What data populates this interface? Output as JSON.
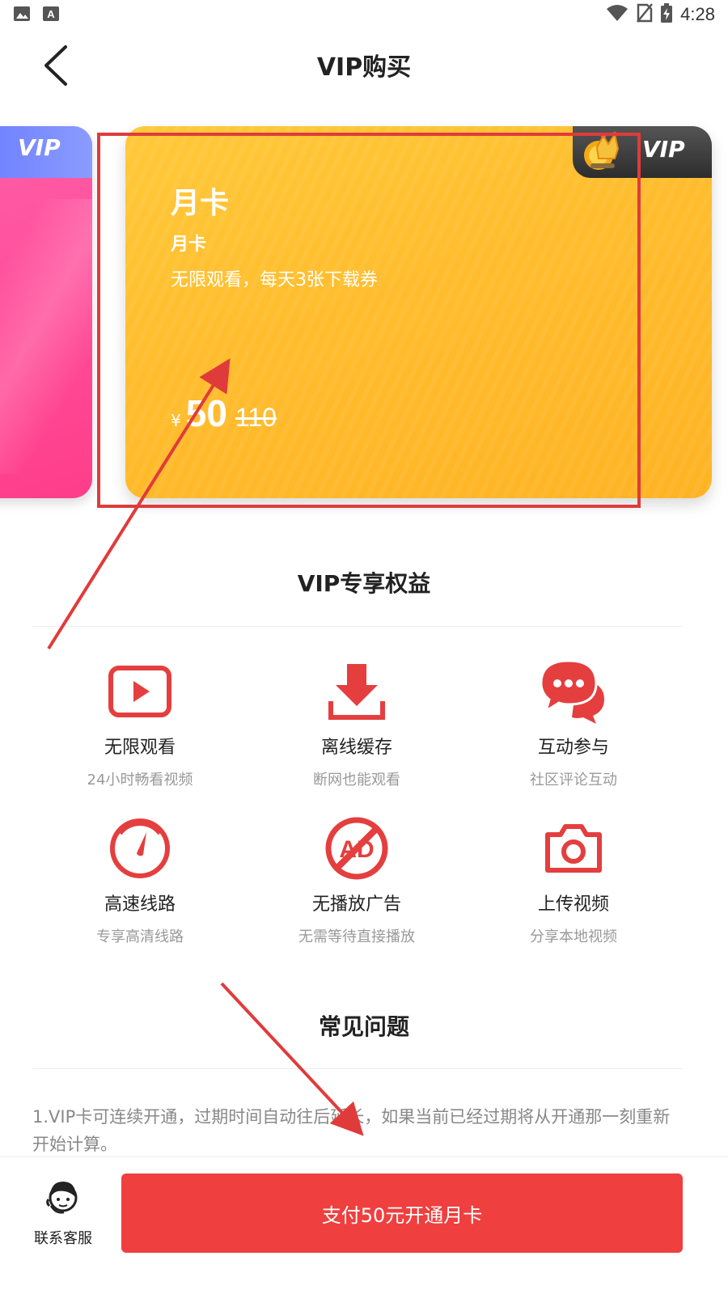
{
  "status_bar": {
    "time": "4:28"
  },
  "header": {
    "title": "VIP购买"
  },
  "cards": {
    "prev_card": {
      "tag": "VIP"
    },
    "selected": {
      "tag": "VIP",
      "name": "月卡",
      "subtitle": "月卡",
      "description": "无限观看，每天3张下载券",
      "currency": "¥",
      "price": "50",
      "original_price": "110"
    }
  },
  "benefits": {
    "title": "VIP专享权益",
    "items": [
      {
        "title": "无限观看",
        "sub": "24小时畅看视频",
        "icon": "play-icon"
      },
      {
        "title": "离线缓存",
        "sub": "断网也能观看",
        "icon": "download-icon"
      },
      {
        "title": "互动参与",
        "sub": "社区评论互动",
        "icon": "chat-icon"
      },
      {
        "title": "高速线路",
        "sub": "专享高清线路",
        "icon": "speedometer-icon"
      },
      {
        "title": "无播放广告",
        "sub": "无需等待直接播放",
        "icon": "no-ad-icon"
      },
      {
        "title": "上传视频",
        "sub": "分享本地视频",
        "icon": "camera-icon"
      }
    ]
  },
  "faq": {
    "title": "常见问题",
    "items": [
      "1.VIP卡可连续开通，过期时间自动往后延长，如果当前已经过期将从开通那一刻重新开始计算。"
    ]
  },
  "bottom": {
    "customer_service": "联系客服",
    "pay_button": "支付50元开通月卡"
  },
  "colors": {
    "accent": "#ef3f3f",
    "gold_card": "#ffbe2e",
    "pink_card": "#ff4f9b",
    "annotation": "#e03b3b"
  }
}
